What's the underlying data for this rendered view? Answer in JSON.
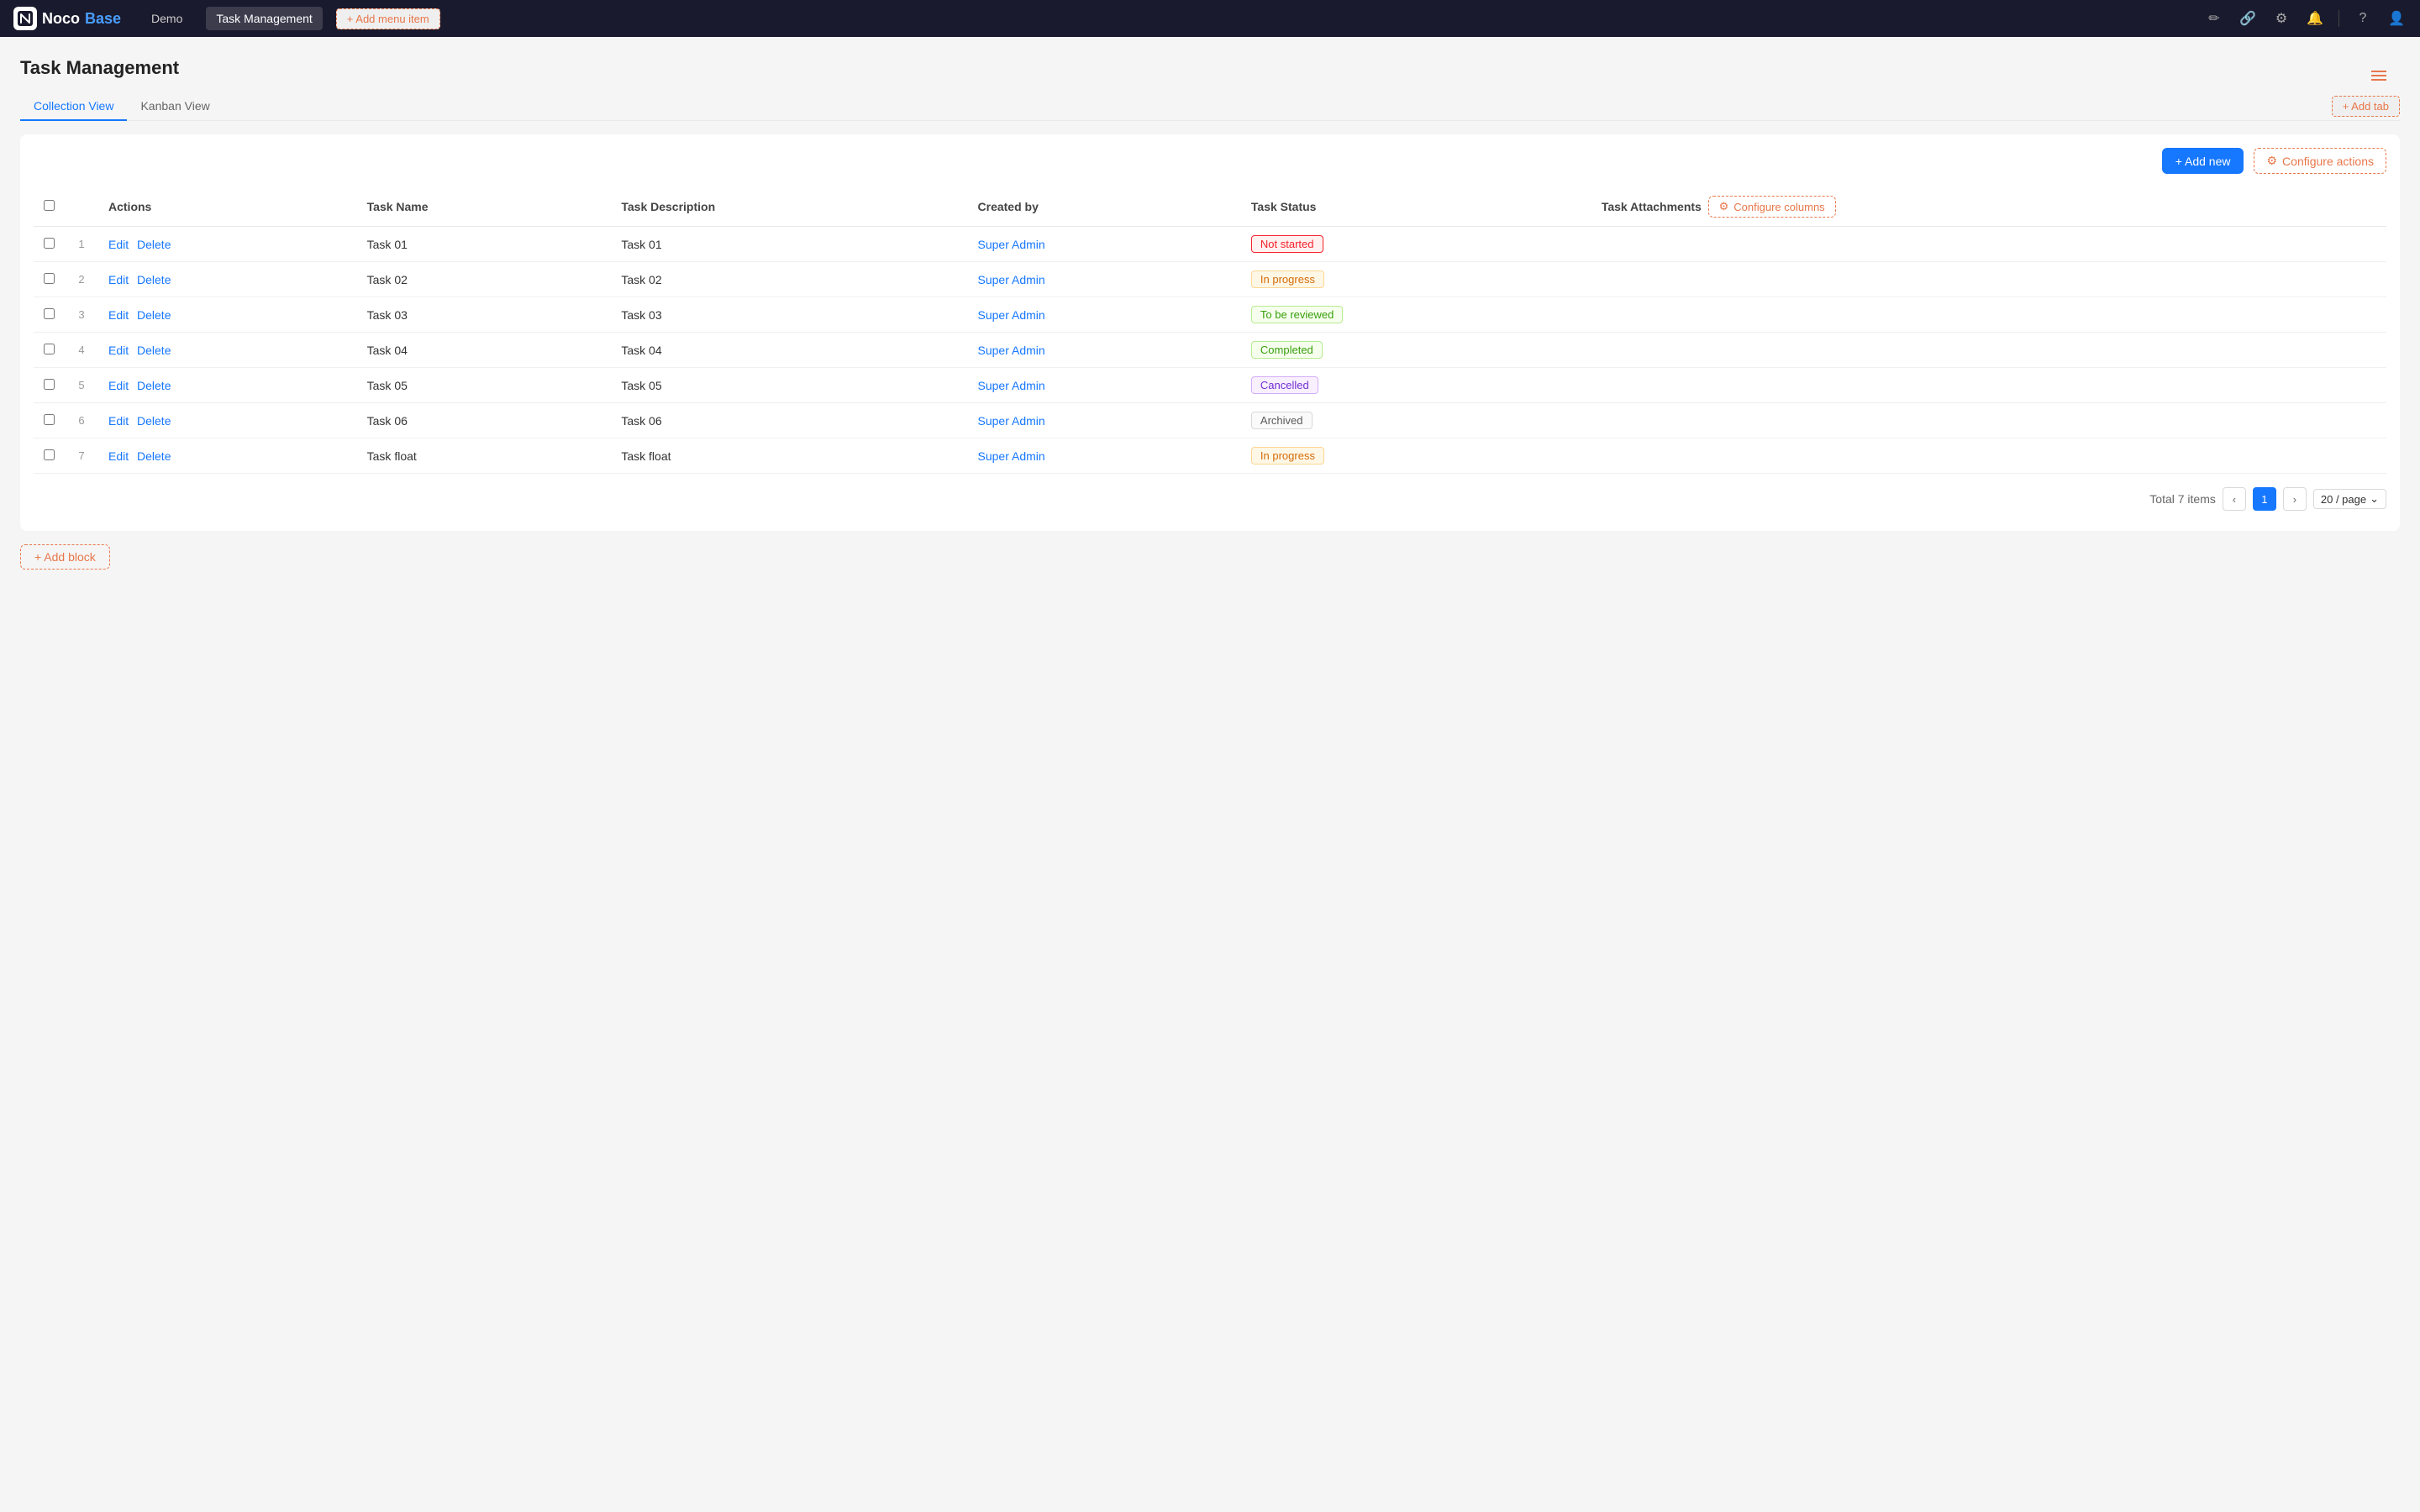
{
  "brand": {
    "name_noco": "Noco",
    "name_base": "Base",
    "logo_symbol": "◆"
  },
  "navbar": {
    "demo_label": "Demo",
    "page_label": "Task Management",
    "add_menu_label": "+ Add menu item",
    "icons": [
      "✏️",
      "🔗",
      "⚙️",
      "🔔",
      "❓",
      "👤"
    ]
  },
  "page": {
    "title": "Task Management",
    "hamburger": true
  },
  "tabs": [
    {
      "label": "Collection View",
      "active": true
    },
    {
      "label": "Kanban View",
      "active": false
    }
  ],
  "add_tab_label": "+ Add tab",
  "toolbar": {
    "add_new_label": "+ Add new",
    "configure_actions_label": "Configure actions"
  },
  "table": {
    "headers": [
      "Actions",
      "Task Name",
      "Task Description",
      "Created by",
      "Task Status",
      "Task Attachments"
    ],
    "configure_columns_label": "Configure columns",
    "rows": [
      {
        "num": 1,
        "actions": [
          "Edit",
          "Delete"
        ],
        "task_name": "Task 01",
        "task_description": "Task 01",
        "created_by": "Super Admin",
        "status": "Not started",
        "status_class": "badge-not-started"
      },
      {
        "num": 2,
        "actions": [
          "Edit",
          "Delete"
        ],
        "task_name": "Task 02",
        "task_description": "Task 02",
        "created_by": "Super Admin",
        "status": "In progress",
        "status_class": "badge-in-progress"
      },
      {
        "num": 3,
        "actions": [
          "Edit",
          "Delete"
        ],
        "task_name": "Task 03",
        "task_description": "Task 03",
        "created_by": "Super Admin",
        "status": "To be reviewed",
        "status_class": "badge-to-be-reviewed"
      },
      {
        "num": 4,
        "actions": [
          "Edit",
          "Delete"
        ],
        "task_name": "Task 04",
        "task_description": "Task 04",
        "created_by": "Super Admin",
        "status": "Completed",
        "status_class": "badge-completed"
      },
      {
        "num": 5,
        "actions": [
          "Edit",
          "Delete"
        ],
        "task_name": "Task 05",
        "task_description": "Task 05",
        "created_by": "Super Admin",
        "status": "Cancelled",
        "status_class": "badge-cancelled"
      },
      {
        "num": 6,
        "actions": [
          "Edit",
          "Delete"
        ],
        "task_name": "Task 06",
        "task_description": "Task 06",
        "created_by": "Super Admin",
        "status": "Archived",
        "status_class": "badge-archived"
      },
      {
        "num": 7,
        "actions": [
          "Edit",
          "Delete"
        ],
        "task_name": "Task float",
        "task_description": "Task float",
        "created_by": "Super Admin",
        "status": "In progress",
        "status_class": "badge-in-progress"
      }
    ]
  },
  "pagination": {
    "total_label": "Total 7 items",
    "current_page": 1,
    "per_page_label": "20 / page"
  },
  "add_block_label": "+ Add block"
}
